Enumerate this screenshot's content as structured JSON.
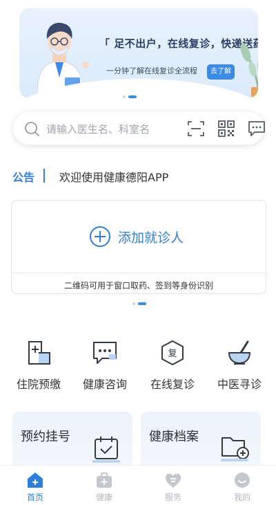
{
  "banner": {
    "title": "「 足不出户，在线复诊，快递送药 」",
    "subtitle": "一分钟了解在线复诊全流程",
    "button_label": "去了解"
  },
  "search": {
    "placeholder": "请输入医生名、科室名"
  },
  "notice": {
    "label": "公告",
    "text": "欢迎使用健康德阳APP"
  },
  "patient_card": {
    "add_label": "添加就诊人",
    "note": "二维码可用于窗口取药、签到等身份识别"
  },
  "services": [
    {
      "label": "住院预缴",
      "icon": "hospital-prepay-icon"
    },
    {
      "label": "健康咨询",
      "icon": "chat-consult-icon"
    },
    {
      "label": "在线复诊",
      "icon": "revisit-hexagon-icon"
    },
    {
      "label": "中医寻诊",
      "icon": "mortar-pestle-icon"
    }
  ],
  "features": [
    {
      "label": "预约挂号",
      "icon": "calendar-check-icon"
    },
    {
      "label": "健康档案",
      "icon": "folder-add-icon"
    }
  ],
  "tabs": [
    {
      "label": "首页",
      "icon": "home-icon",
      "active": true
    },
    {
      "label": "健康",
      "icon": "medkit-icon",
      "active": false
    },
    {
      "label": "服务",
      "icon": "heart-service-icon",
      "active": false
    },
    {
      "label": "我的",
      "icon": "profile-icon",
      "active": false
    }
  ],
  "colors": {
    "accent": "#2f7fd8",
    "banner_button": "#3b8ae6",
    "tab_inactive": "#b5b8bd"
  }
}
